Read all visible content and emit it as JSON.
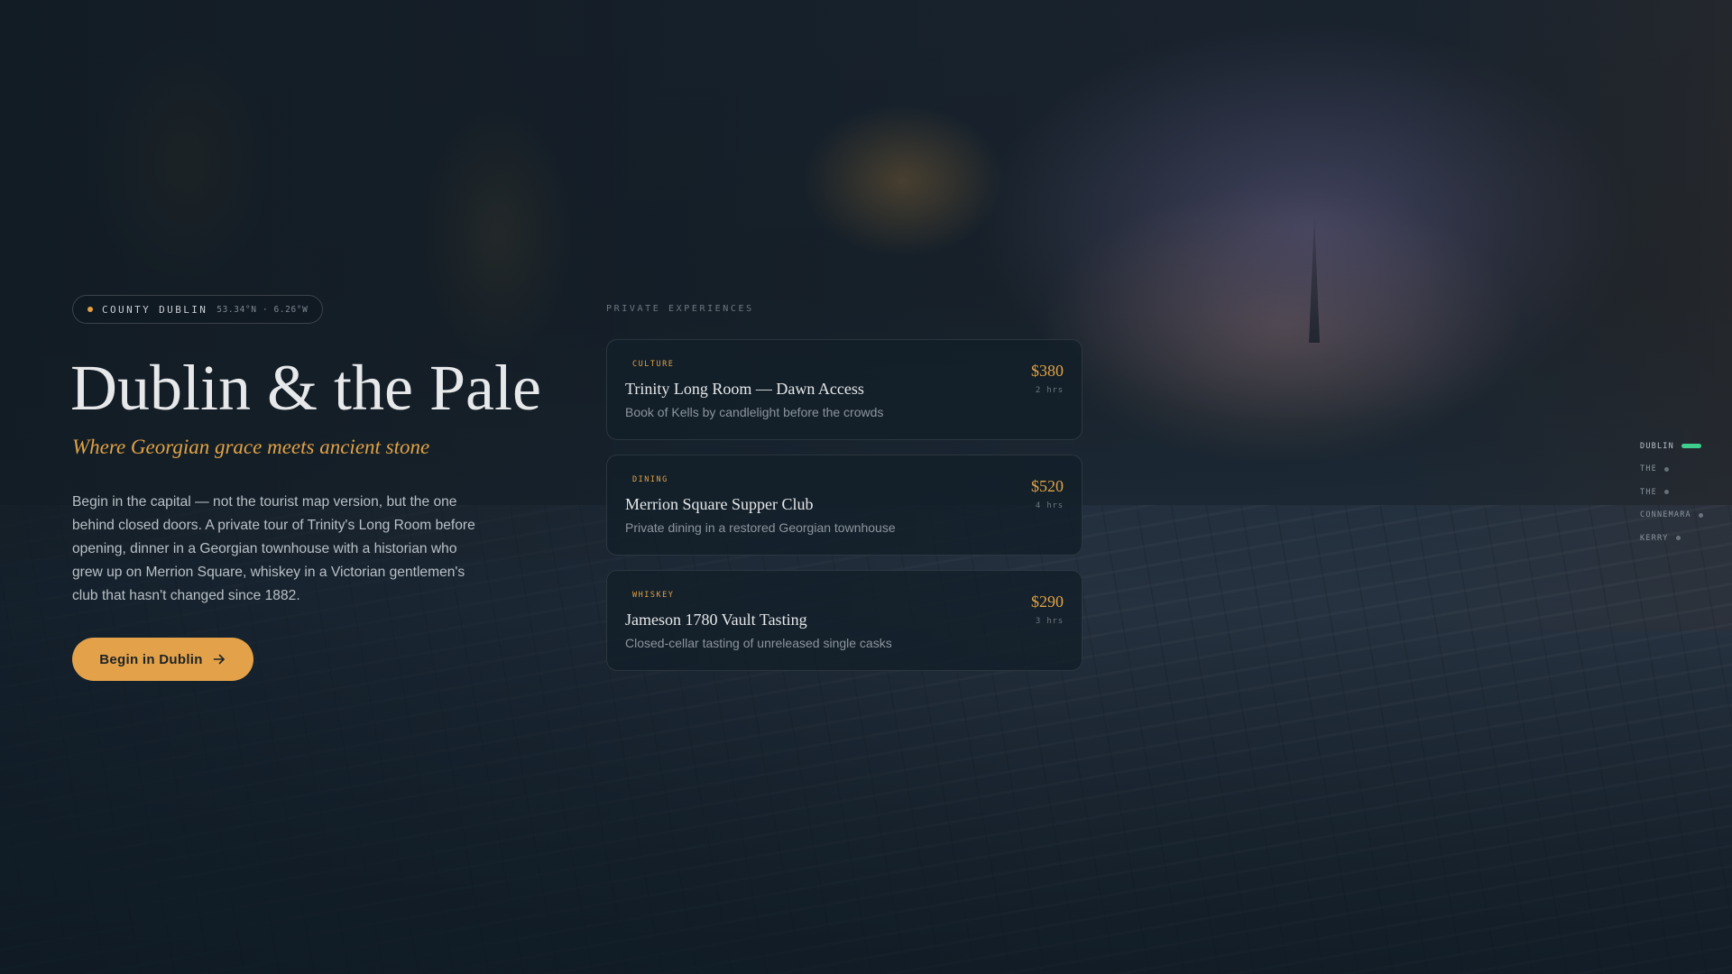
{
  "hero": {
    "location_name": "COUNTY DUBLIN",
    "location_coords": "53.34°N · 6.26°W",
    "title": "Dublin & the Pale",
    "subtitle": "Where Georgian grace meets ancient stone",
    "description": "Begin in the capital — not the tourist map version, but the one behind closed doors. A private tour of Trinity's Long Room before opening, dinner in a Georgian townhouse with a historian who grew up on Merrion Square, whiskey in a Victorian gentlemen's club that hasn't changed since 1882.",
    "cta_label": "Begin in Dublin",
    "cta_icon": "arrow-right-icon"
  },
  "experiences": {
    "section_label": "PRIVATE EXPERIENCES",
    "items": [
      {
        "category": "CULTURE",
        "title": "Trinity Long Room — Dawn Access",
        "description": "Book of Kells by candlelight before the crowds",
        "price": "$380",
        "duration": "2 hrs"
      },
      {
        "category": "DINING",
        "title": "Merrion Square Supper Club",
        "description": "Private dining in a restored Georgian townhouse",
        "price": "$520",
        "duration": "4 hrs"
      },
      {
        "category": "WHISKEY",
        "title": "Jameson 1780 Vault Tasting",
        "description": "Closed-cellar tasting of unreleased single casks",
        "price": "$290",
        "duration": "3 hrs"
      }
    ]
  },
  "region_nav": {
    "active_index": 0,
    "items": [
      "DUBLIN",
      "THE",
      "THE",
      "CONNEMARA",
      "KERRY"
    ]
  },
  "colors": {
    "accent": "#e0a246",
    "active_marker": "#3ecf8e",
    "background": "#0f1a22"
  }
}
